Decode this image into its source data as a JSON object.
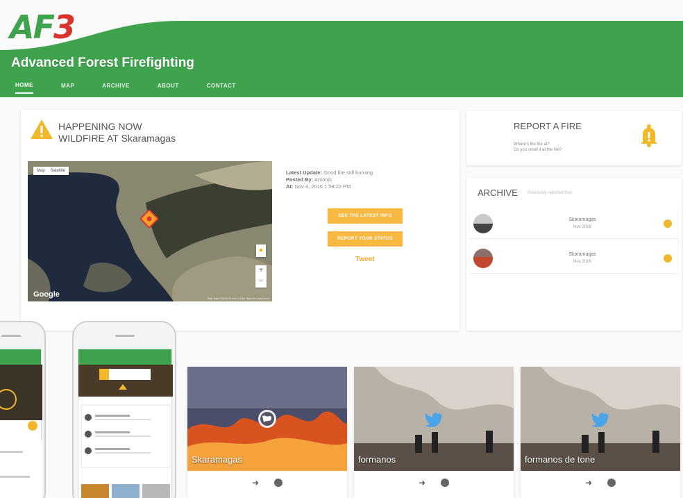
{
  "logo": {
    "part1": "AF",
    "part2": "3"
  },
  "site_title": "Advanced Forest Firefighting",
  "colors": {
    "brand_green": "#3fa34d",
    "accent_orange": "#f7b942",
    "logo_red": "#d9342b"
  },
  "nav": {
    "items": [
      "HOME",
      "MAP",
      "ARCHIVE",
      "ABOUT",
      "CONTACT"
    ],
    "active": "HOME"
  },
  "alert": {
    "line1": "HAPPENING NOW",
    "line2": "WILDFIRE AT Skaramagas",
    "icon": "warning-icon"
  },
  "map": {
    "toggle_map": "Map",
    "toggle_sat": "Satellite",
    "brand": "Google",
    "footer": "Map data ©2016 Terms of Use Report a map error"
  },
  "update": {
    "latest_label": "Latest Update:",
    "latest_value": "Good fire still burning",
    "posted_label": "Posted By:",
    "posted_value": "Antonis",
    "at_label": "At:",
    "at_value": "Nov 4, 2016 1:59:22 PM"
  },
  "buttons": {
    "latest": "See the latest info",
    "report": "Report your status",
    "tweet": "Tweet"
  },
  "report": {
    "title": "REPORT A FIRE",
    "sub1": "Where's the fire at?",
    "sub2": "Do you smell it at the fire?",
    "icon": "bell-icon"
  },
  "archive": {
    "title": "ARCHIVE",
    "subtitle": "Previously reported fires",
    "rows": [
      {
        "place": "Skaramagas",
        "date": "Nov 2016"
      },
      {
        "place": "Skaramagas",
        "date": "Nov 2016"
      }
    ]
  },
  "tiles": [
    {
      "label": "Skaramagas",
      "icon": "globe-icon"
    },
    {
      "label": "formanos",
      "icon": "twitter-icon"
    },
    {
      "label": "formanos de tone",
      "icon": "twitter-icon"
    }
  ]
}
